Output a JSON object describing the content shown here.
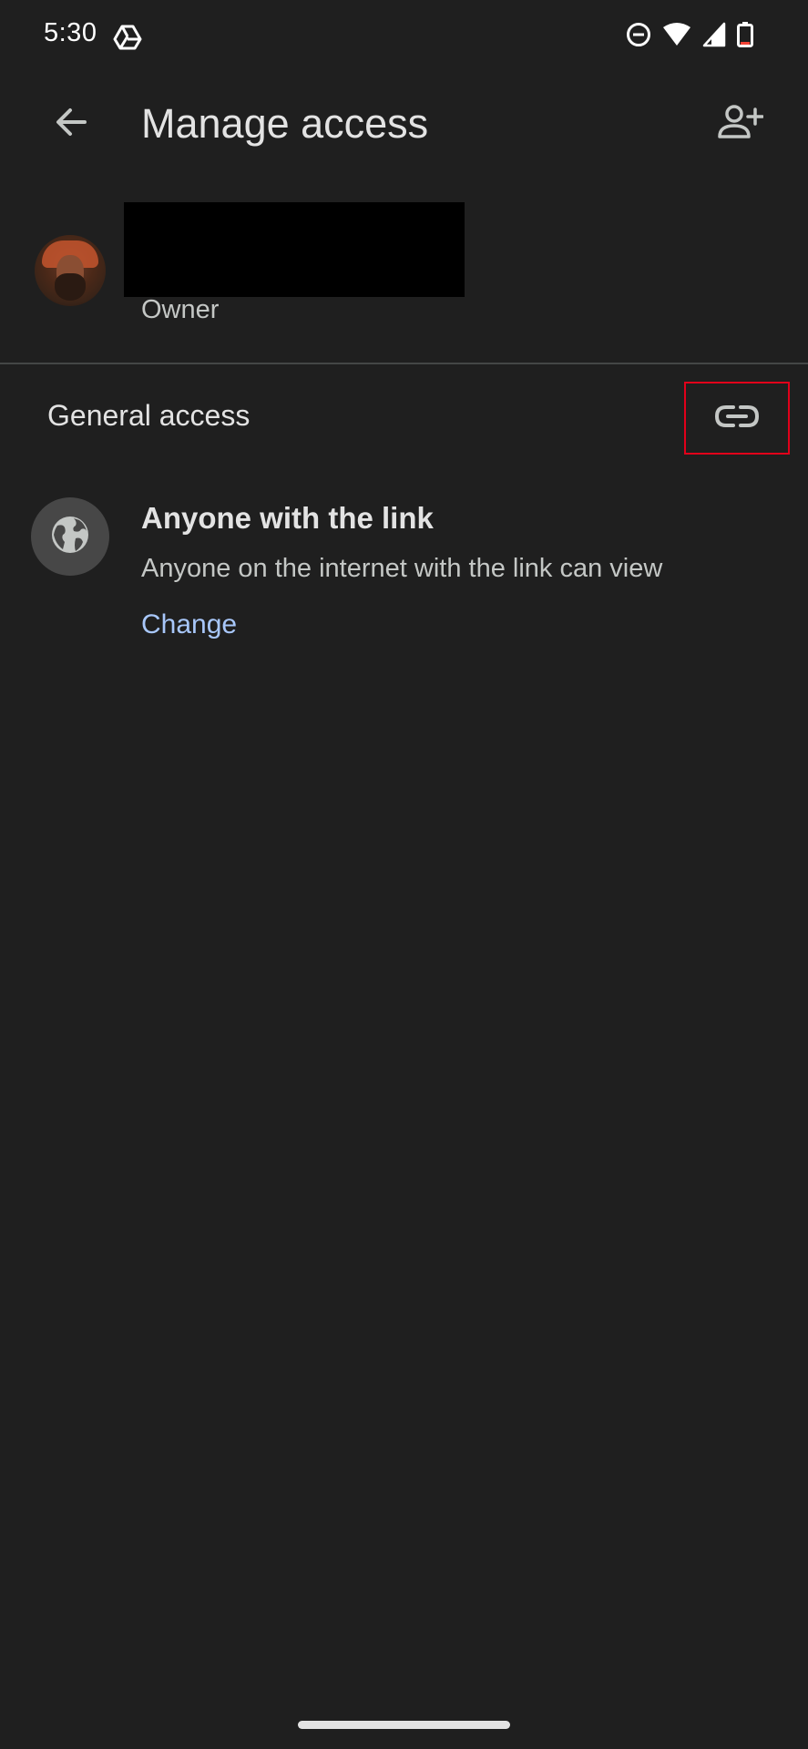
{
  "status_bar": {
    "time": "5:30",
    "icons": [
      "google-drive-icon",
      "do-not-disturb-icon",
      "wifi-icon",
      "signal-icon",
      "battery-icon"
    ]
  },
  "app_bar": {
    "title": "Manage access",
    "back_icon": "arrow-back-icon",
    "add_person_icon": "person-add-icon"
  },
  "owner": {
    "role": "Owner"
  },
  "general_access": {
    "header": "General access",
    "copy_link_icon": "link-icon",
    "setting": {
      "icon": "globe-icon",
      "title": "Anyone with the link",
      "description": "Anyone on the internet with the link can view",
      "change_label": "Change"
    }
  },
  "colors": {
    "background": "#1f1f1f",
    "accent": "#a8c7fa",
    "highlight_box": "#e1001a",
    "divider": "#444746"
  }
}
